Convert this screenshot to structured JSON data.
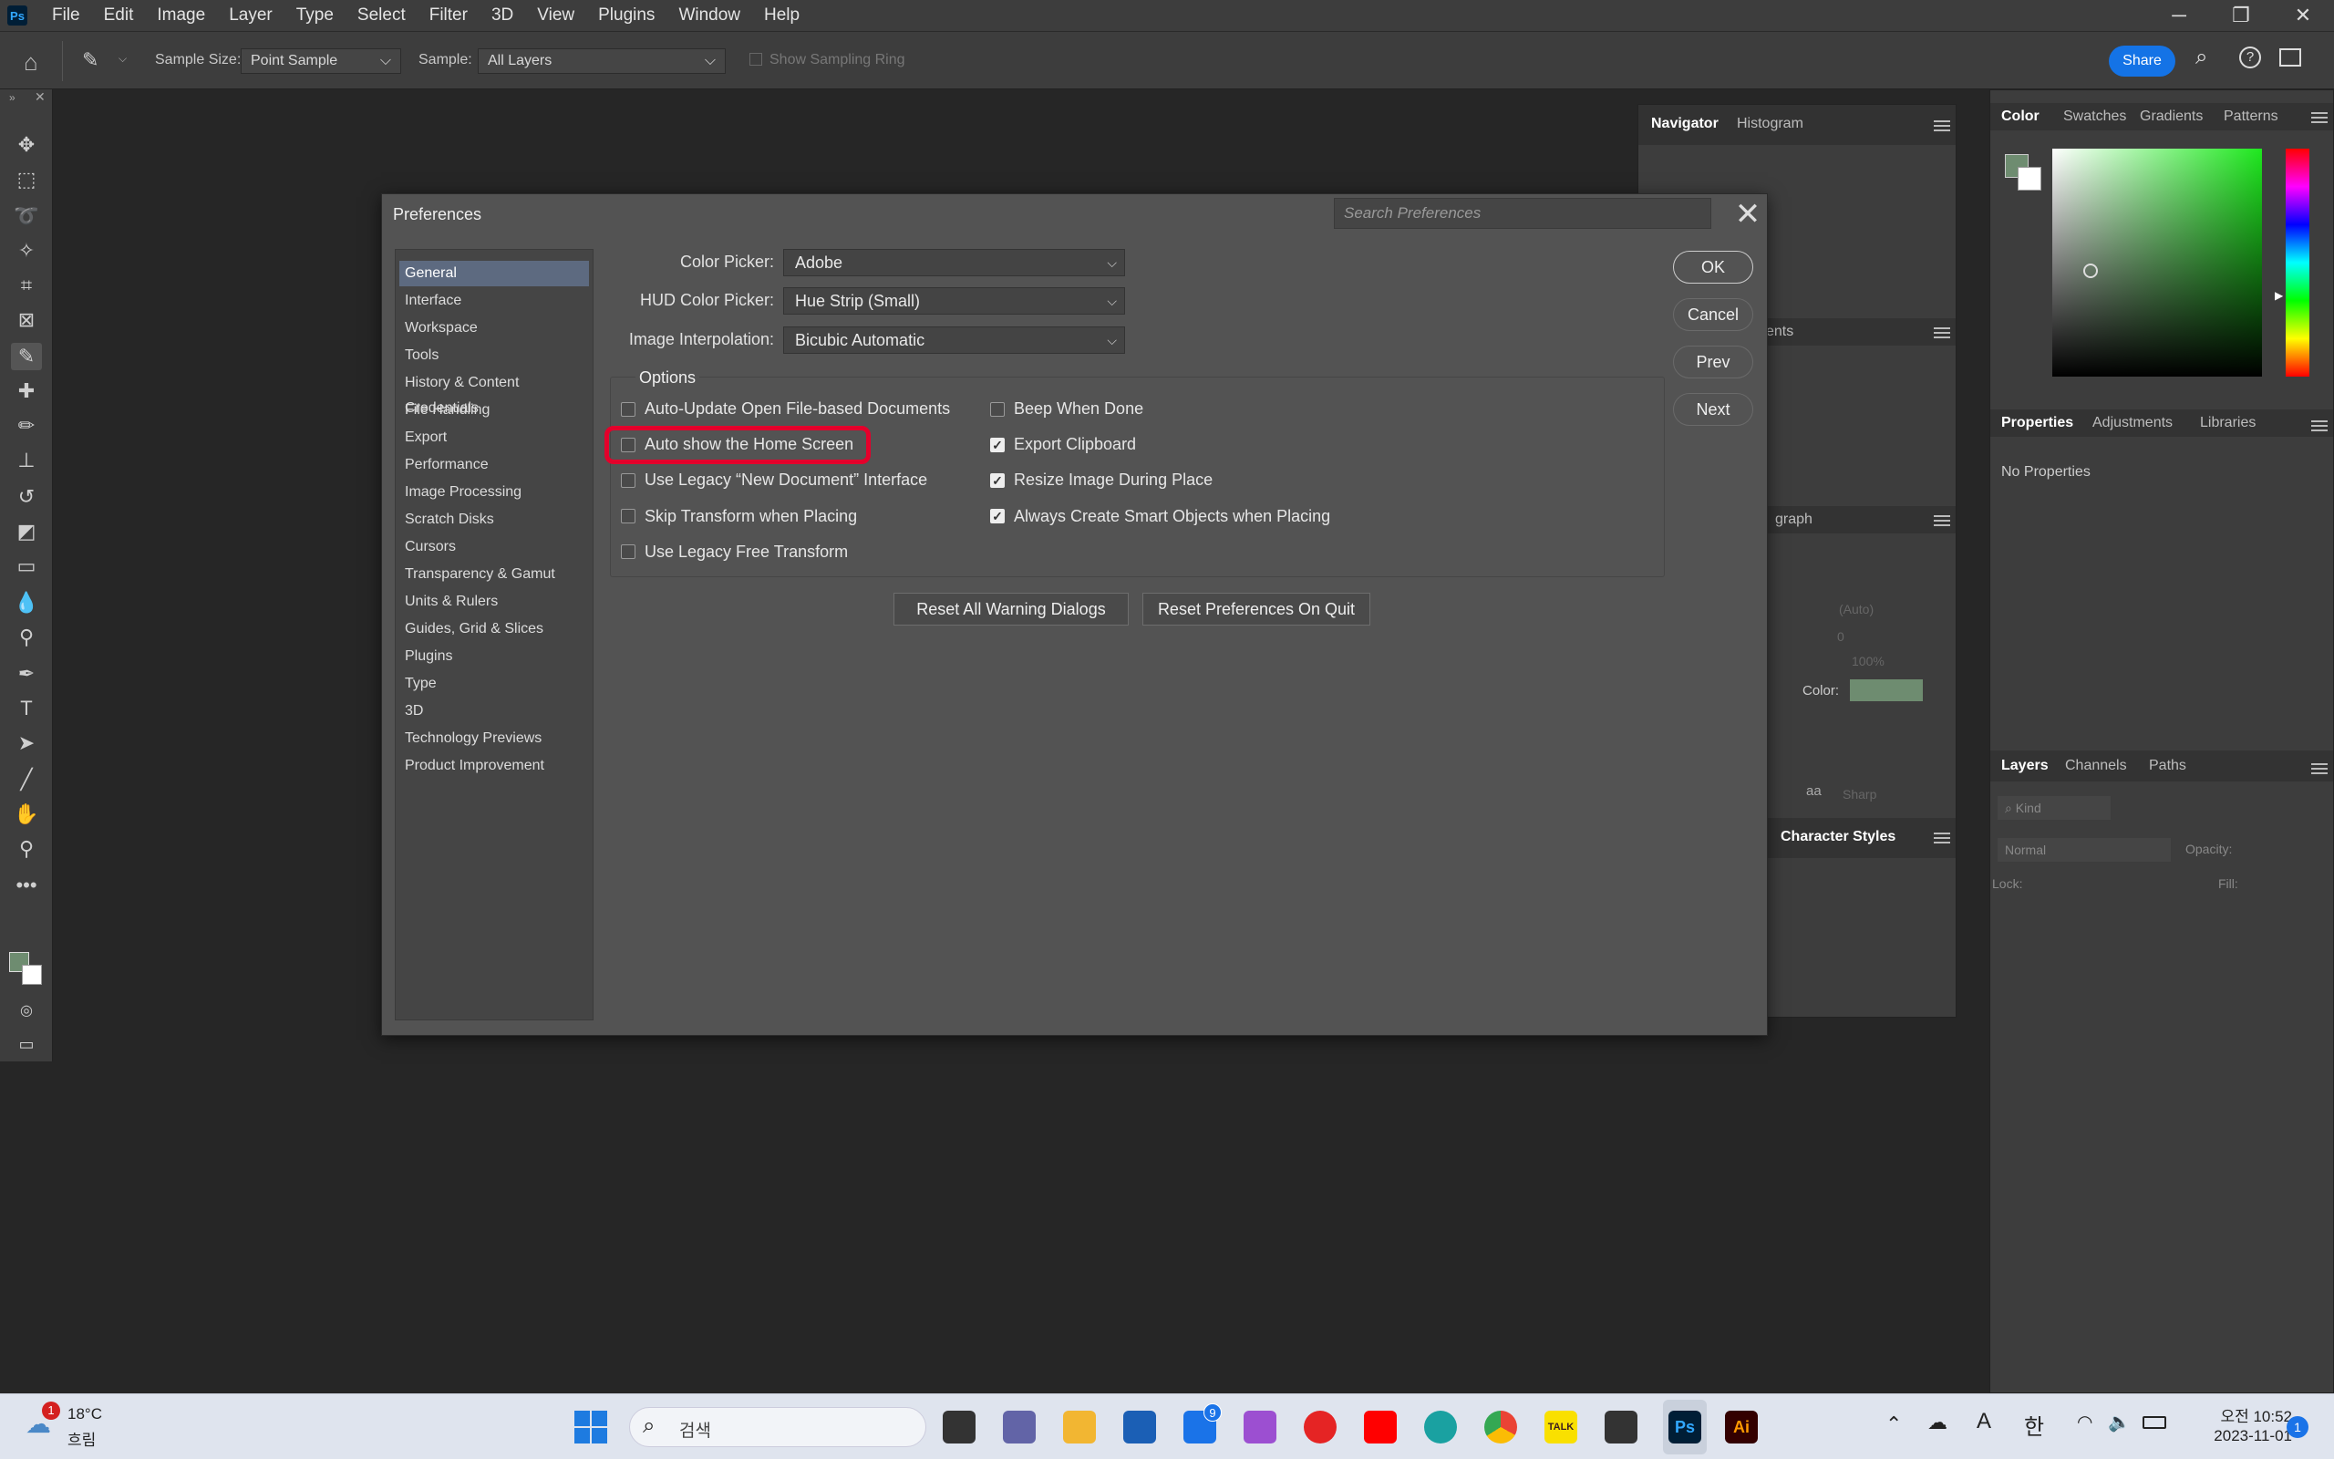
{
  "app": {
    "logo": "Ps",
    "menu": [
      "File",
      "Edit",
      "Image",
      "Layer",
      "Type",
      "Select",
      "Filter",
      "3D",
      "View",
      "Plugins",
      "Window",
      "Help"
    ],
    "window_controls": [
      "─",
      "❐",
      "✕"
    ]
  },
  "options_bar": {
    "sample_size_label": "Sample Size:",
    "sample_size_value": "Point Sample",
    "sample_label": "Sample:",
    "sample_value": "All Layers",
    "sampling_ring_label": "Show Sampling Ring",
    "share_label": "Share"
  },
  "panels": {
    "navigator_tabs": [
      "Navigator",
      "Histogram"
    ],
    "color_tabs": [
      "Color",
      "Swatches",
      "Gradients",
      "Patterns"
    ],
    "properties_tabs": [
      "Properties",
      "Adjustments",
      "Libraries"
    ],
    "properties_empty": "No Properties",
    "layers_tabs": [
      "Layers",
      "Channels",
      "Paths"
    ],
    "layers_kind": "Kind",
    "blend_mode": "Normal",
    "opacity_label": "Opacity:",
    "lock_label": "Lock:",
    "fill_label": "Fill:",
    "partial_tab_1": "ents",
    "partial_tab_2": "graph",
    "char_styles": "Character Styles",
    "char_auto": "(Auto)",
    "char_zero": "0",
    "char_pct": "100%",
    "char_color_label": "Color:",
    "char_sharp": "Sharp",
    "char_aa": "aa"
  },
  "dialog": {
    "title": "Preferences",
    "search_placeholder": "Search Preferences",
    "categories": [
      "General",
      "Interface",
      "Workspace",
      "Tools",
      "History & Content Credentials",
      "File Handling",
      "Export",
      "Performance",
      "Image Processing",
      "Scratch Disks",
      "Cursors",
      "Transparency & Gamut",
      "Units & Rulers",
      "Guides, Grid & Slices",
      "Plugins",
      "Type",
      "3D",
      "Technology Previews",
      "Product Improvement"
    ],
    "active_category": "General",
    "color_picker_label": "Color Picker:",
    "color_picker_value": "Adobe",
    "hud_label": "HUD Color Picker:",
    "hud_value": "Hue Strip (Small)",
    "interp_label": "Image Interpolation:",
    "interp_value": "Bicubic Automatic",
    "options_title": "Options",
    "options_left": [
      {
        "label": "Auto-Update Open File-based Documents",
        "checked": false
      },
      {
        "label": "Auto show the Home Screen",
        "checked": false
      },
      {
        "label": "Use Legacy “New Document” Interface",
        "checked": false
      },
      {
        "label": "Skip Transform when Placing",
        "checked": false
      },
      {
        "label": "Use Legacy Free Transform",
        "checked": false
      }
    ],
    "options_right": [
      {
        "label": "Beep When Done",
        "checked": false
      },
      {
        "label": "Export Clipboard",
        "checked": true
      },
      {
        "label": "Resize Image During Place",
        "checked": true
      },
      {
        "label": "Always Create Smart Objects when Placing",
        "checked": true
      }
    ],
    "reset_warnings": "Reset All Warning Dialogs",
    "reset_prefs": "Reset Preferences On Quit",
    "ok": "OK",
    "cancel": "Cancel",
    "prev": "Prev",
    "next": "Next"
  },
  "taskbar": {
    "weather_temp": "18°C",
    "weather_desc": "흐림",
    "weather_badge": "1",
    "search_placeholder": "검색",
    "mail_badge": "9",
    "time": "오전 10:52",
    "date": "2023-11-01",
    "ime_a": "A",
    "ime_han": "한",
    "notif_badge": "1",
    "illustrator_label": "Ai",
    "ps_label": "Ps",
    "talk_label": "TALK"
  }
}
